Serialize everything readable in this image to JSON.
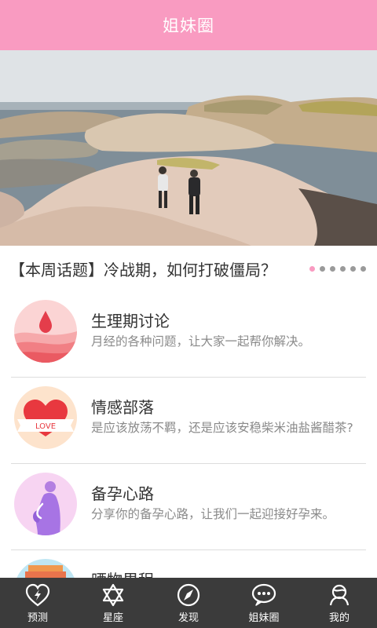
{
  "header": {
    "title": "姐妹圈"
  },
  "banner": {
    "topic": "【本周话题】冷战期，如何打破僵局？",
    "slide_count": 6,
    "active_slide": 1
  },
  "colors": {
    "accent": "#f99bc1",
    "tabbar": "#3b3b3b"
  },
  "list": {
    "items": [
      {
        "title": "生理期讨论",
        "desc": "月经的各种问题，让大家一起帮你解决。",
        "icon": "droplet-icon"
      },
      {
        "title": "情感部落",
        "desc": "是应该放荡不羁，还是应该安稳柴米油盐酱醋茶?",
        "icon": "love-heart-icon",
        "badge": "LOVE"
      },
      {
        "title": "备孕心路",
        "desc": "分享你的备孕心路，让我们一起迎接好孕来。",
        "icon": "pregnant-woman-icon"
      },
      {
        "title": "晒物里程",
        "desc": "",
        "icon": "books-icon"
      }
    ]
  },
  "tabbar": {
    "tabs": [
      {
        "label": "预测",
        "icon": "heart-bolt-icon"
      },
      {
        "label": "星座",
        "icon": "star-of-david-icon"
      },
      {
        "label": "发现",
        "icon": "compass-icon"
      },
      {
        "label": "姐妹圈",
        "icon": "chat-bubble-icon"
      },
      {
        "label": "我的",
        "icon": "user-profile-icon"
      }
    ]
  }
}
